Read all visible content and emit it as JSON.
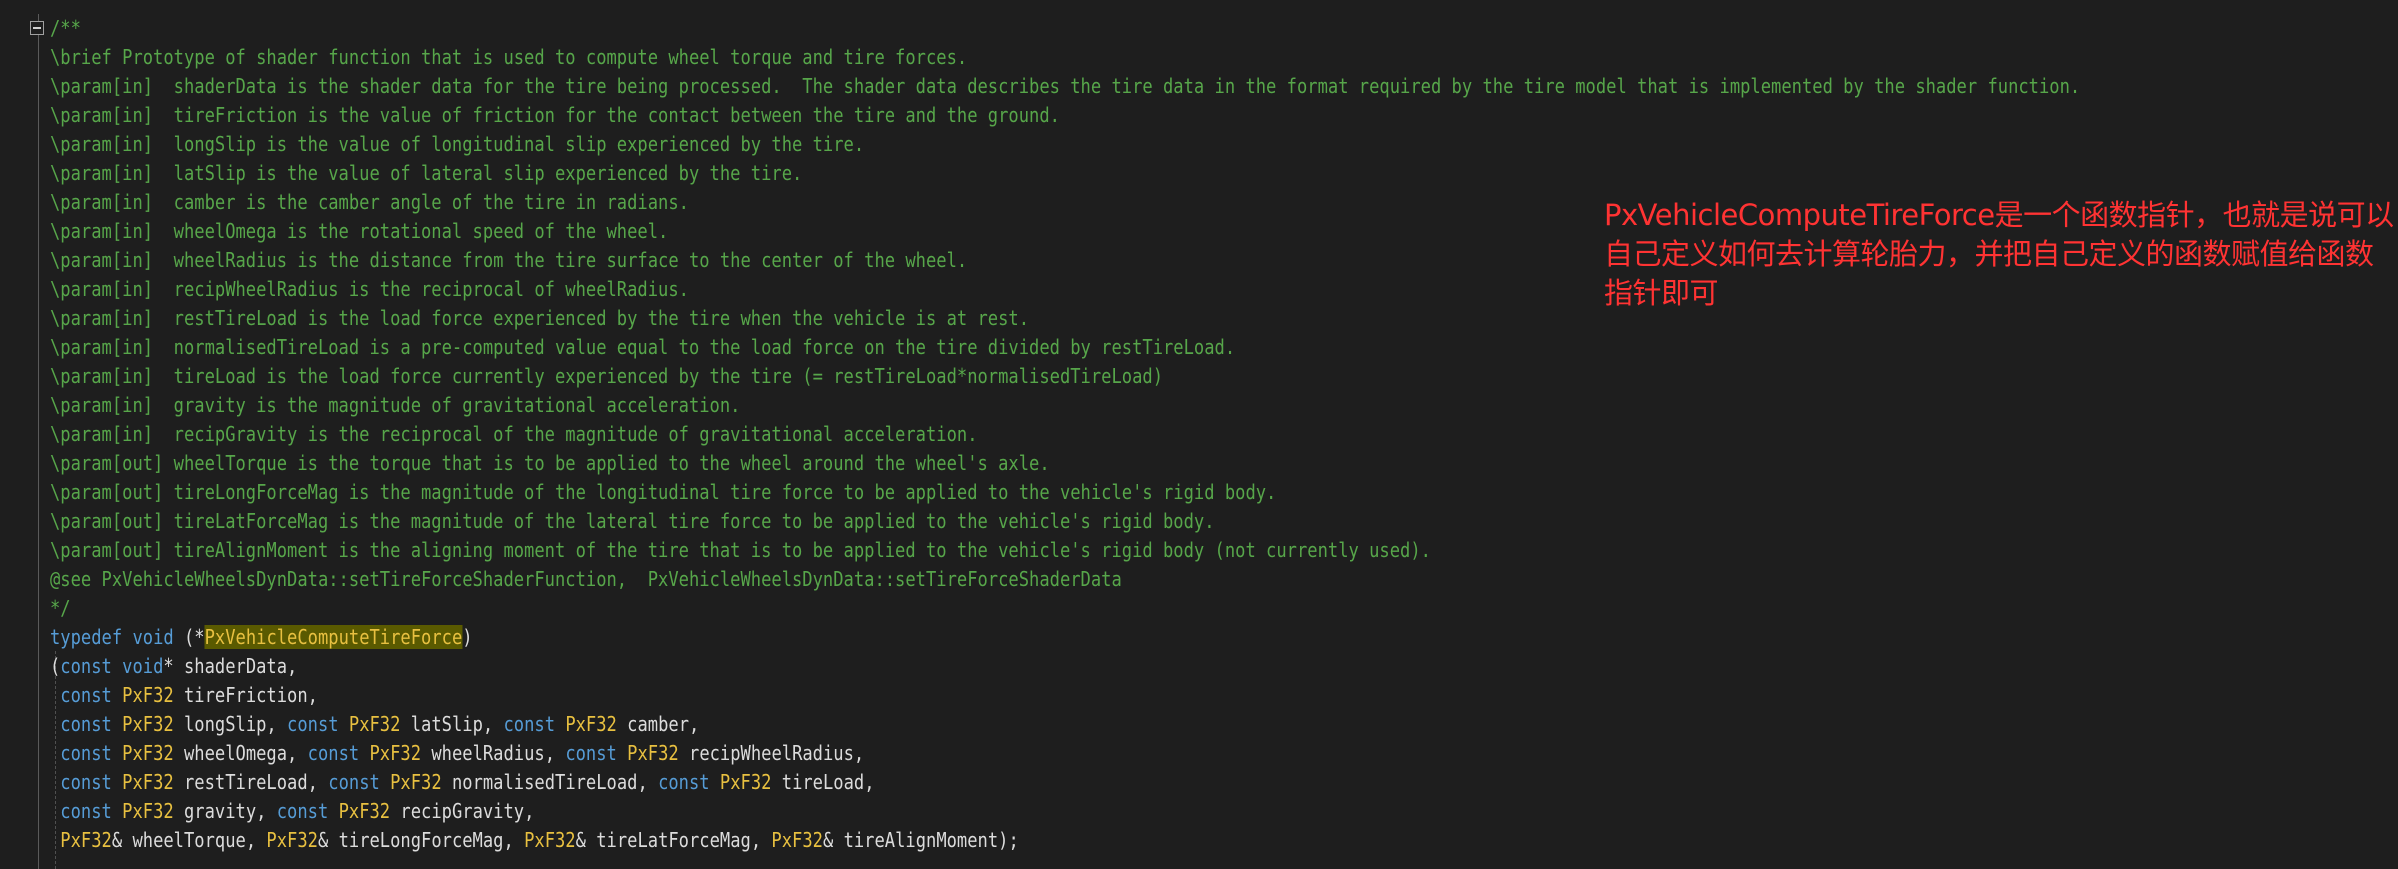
{
  "comment": {
    "open": "/**",
    "brief": "\\brief Prototype of shader function that is used to compute wheel torque and tire forces.",
    "params": [
      "\\param[in]  shaderData is the shader data for the tire being processed.  The shader data describes the tire data in the format required by the tire model that is implemented by the shader function.",
      "\\param[in]  tireFriction is the value of friction for the contact between the tire and the ground.",
      "\\param[in]  longSlip is the value of longitudinal slip experienced by the tire.",
      "\\param[in]  latSlip is the value of lateral slip experienced by the tire.",
      "\\param[in]  camber is the camber angle of the tire in radians.",
      "\\param[in]  wheelOmega is the rotational speed of the wheel.",
      "\\param[in]  wheelRadius is the distance from the tire surface to the center of the wheel.",
      "\\param[in]  recipWheelRadius is the reciprocal of wheelRadius.",
      "\\param[in]  restTireLoad is the load force experienced by the tire when the vehicle is at rest.",
      "\\param[in]  normalisedTireLoad is a pre-computed value equal to the load force on the tire divided by restTireLoad.",
      "\\param[in]  tireLoad is the load force currently experienced by the tire (= restTireLoad*normalisedTireLoad)",
      "\\param[in]  gravity is the magnitude of gravitational acceleration.",
      "\\param[in]  recipGravity is the reciprocal of the magnitude of gravitational acceleration.",
      "\\param[out] wheelTorque is the torque that is to be applied to the wheel around the wheel's axle.",
      "\\param[out] tireLongForceMag is the magnitude of the longitudinal tire force to be applied to the vehicle's rigid body.",
      "\\param[out] tireLatForceMag is the magnitude of the lateral tire force to be applied to the vehicle's rigid body.",
      "\\param[out] tireAlignMoment is the aligning moment of the tire that is to be applied to the vehicle's rigid body (not currently used)."
    ],
    "see": "@see PxVehicleWheelsDynData::setTireForceShaderFunction,  PxVehicleWheelsDynData::setTireForceShaderData",
    "close": "*/"
  },
  "code": {
    "typedef_kw": "typedef",
    "void_kw": "void",
    "open_ptr": " (*",
    "func_name": "PxVehicleComputeTireForce",
    "close_paren": ")",
    "const_kw": "const",
    "type": "PxF32",
    "line1_open": "(",
    "line1_rest": "* shaderData,",
    "line2_rest": " tireFriction,",
    "line3_a": " longSlip, ",
    "line3_b": " latSlip, ",
    "line3_c": " camber,",
    "line4_a": " wheelOmega, ",
    "line4_b": " wheelRadius, ",
    "line4_c": " recipWheelRadius,",
    "line5_a": " restTireLoad, ",
    "line5_b": " normalisedTireLoad, ",
    "line5_c": " tireLoad,",
    "line6_a": " gravity, ",
    "line6_b": " recipGravity,",
    "line7_a": "& wheelTorque, ",
    "line7_b": "& tireLongForceMag, ",
    "line7_c": "& tireLatForceMag, ",
    "line7_d": "& tireAlignMoment",
    "line7_end": ");"
  },
  "annotation": "PxVehicleComputeTireForce是一个函数指针，也就是说可以自己定义如何去计算轮胎力，并把自己定义的函数赋值给函数指针即可",
  "colors": {
    "background": "#1e1e1e",
    "comment": "#57a64a",
    "keyword": "#569cd6",
    "type": "#e8c040",
    "identifier": "#dcdcdc",
    "highlight": "#5a5a00",
    "annotation": "#ff3333"
  },
  "icons": {
    "fold": "collapse-minus-icon"
  }
}
